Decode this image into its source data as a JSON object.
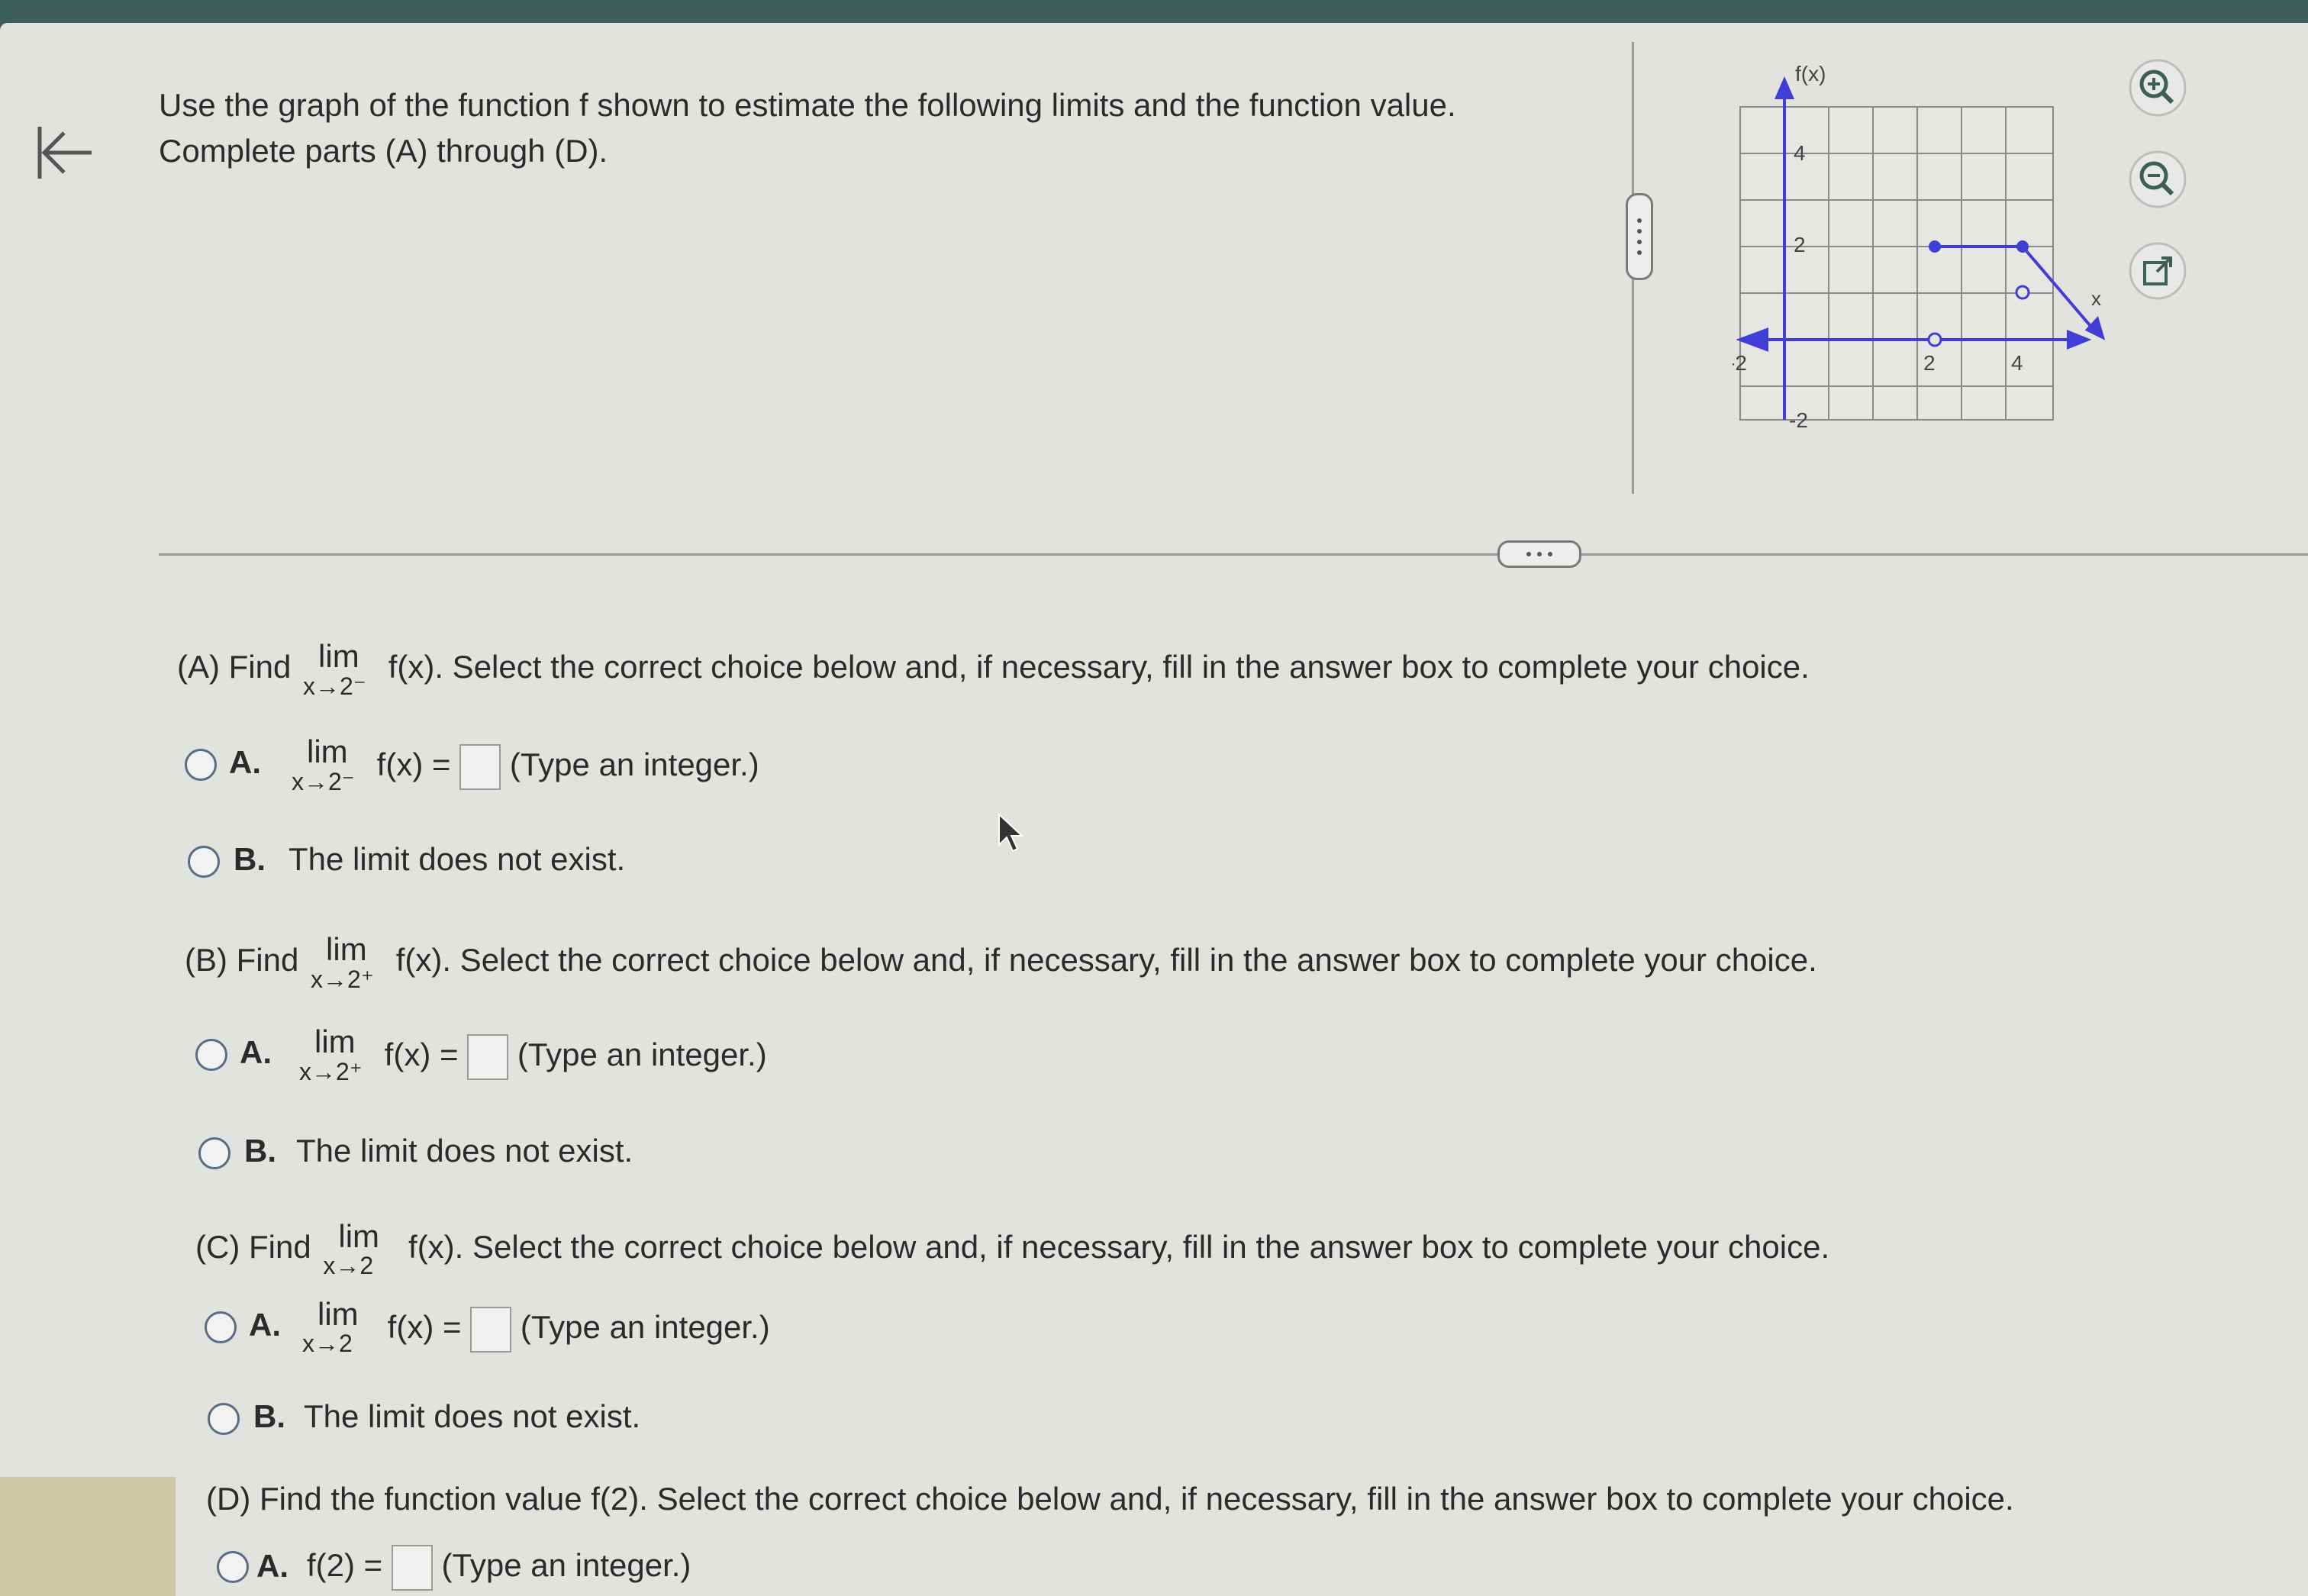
{
  "prompt": {
    "line1": "Use the graph of the function f shown to estimate the following limits and the function value.",
    "line2": "Complete parts (A) through (D)."
  },
  "graph": {
    "ylabel": "f(x)",
    "xlabel": "x",
    "x_ticks": [
      "-2",
      "2",
      "4"
    ],
    "y_ticks": [
      "4",
      "2",
      "-2"
    ],
    "curve_color": "#3f3fd6"
  },
  "toolbar": {
    "zoom_in_icon": "zoom-in-icon",
    "zoom_out_icon": "zoom-out-icon",
    "popout_icon": "external-link-icon"
  },
  "parts": [
    {
      "prefix": "(A) Find",
      "lim": "lim",
      "sub": "x→2⁻",
      "suffix": "f(x). Select the correct choice below and, if necessary, fill in the answer box to complete your choice.",
      "choiceA": {
        "letter": "A.",
        "lim": "lim",
        "sub": "x→2⁻",
        "expr": "f(x) =",
        "hint": "(Type an integer.)"
      },
      "choiceB": {
        "letter": "B.",
        "text": "The limit does not exist."
      }
    },
    {
      "prefix": "(B) Find",
      "lim": "lim",
      "sub": "x→2⁺",
      "suffix": "f(x). Select the correct choice below and, if necessary, fill in the answer box to complete your choice.",
      "choiceA": {
        "letter": "A.",
        "lim": "lim",
        "sub": "x→2⁺",
        "expr": "f(x) =",
        "hint": "(Type an integer.)"
      },
      "choiceB": {
        "letter": "B.",
        "text": "The limit does not exist."
      }
    },
    {
      "prefix": "(C) Find",
      "lim": "lim",
      "sub": "x→2",
      "suffix": "f(x). Select the correct choice below and, if necessary, fill in the answer box to complete your choice.",
      "choiceA": {
        "letter": "A.",
        "lim": "lim",
        "sub": "x→2",
        "expr": "f(x) =",
        "hint": "(Type an integer.)"
      },
      "choiceB": {
        "letter": "B.",
        "text": "The limit does not exist."
      }
    },
    {
      "prefix": "(D) Find the function value f(2). Select the correct choice below and, if necessary, fill in the answer box to complete your choice.",
      "choiceA": {
        "letter": "A.",
        "expr": "f(2) =",
        "hint": "(Type an integer.)"
      }
    }
  ]
}
